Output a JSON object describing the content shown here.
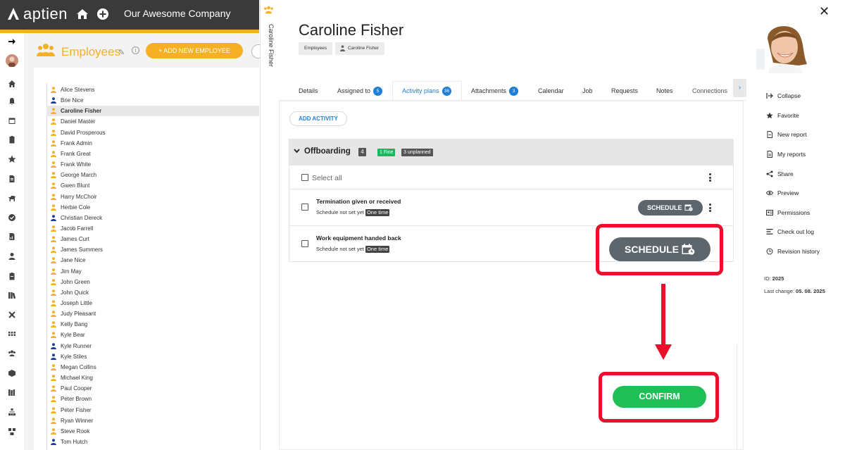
{
  "app": {
    "logo_text": "aptien",
    "company": "Our Awesome Company"
  },
  "employees_panel": {
    "title": "Employees",
    "add_button": "+ ADD NEW EMPLOYEE",
    "info_glyph": "i",
    "employees": [
      {
        "name": "Alice Stevens",
        "color": "#f5b025",
        "selected": false
      },
      {
        "name": "Brie Nice",
        "color": "#1f3f9c",
        "selected": false
      },
      {
        "name": "Caroline Fisher",
        "color": "#f5b025",
        "selected": true
      },
      {
        "name": "Daniel Master",
        "color": "#f5b025",
        "selected": false
      },
      {
        "name": "David Prosperous",
        "color": "#f5b025",
        "selected": false
      },
      {
        "name": "Frank Admin",
        "color": "#f5b025",
        "selected": false
      },
      {
        "name": "Frank Great",
        "color": "#f5b025",
        "selected": false
      },
      {
        "name": "Frank White",
        "color": "#f5b025",
        "selected": false
      },
      {
        "name": "George March",
        "color": "#f5b025",
        "selected": false
      },
      {
        "name": "Gwen Blunt",
        "color": "#f5b025",
        "selected": false
      },
      {
        "name": "Harry McChoir",
        "color": "#f5b025",
        "selected": false
      },
      {
        "name": "Herbie Cole",
        "color": "#f5b025",
        "selected": false
      },
      {
        "name": "Christian Dereck",
        "color": "#1f3f9c",
        "selected": false
      },
      {
        "name": "Jacob Farrell",
        "color": "#f5b025",
        "selected": false
      },
      {
        "name": "James Curt",
        "color": "#f5b025",
        "selected": false
      },
      {
        "name": "James Summers",
        "color": "#f5b025",
        "selected": false
      },
      {
        "name": "Jane Nice",
        "color": "#f5b025",
        "selected": false
      },
      {
        "name": "Jim May",
        "color": "#f5b025",
        "selected": false
      },
      {
        "name": "John Green",
        "color": "#f5b025",
        "selected": false
      },
      {
        "name": "John Quick",
        "color": "#f5b025",
        "selected": false
      },
      {
        "name": "Joseph Little",
        "color": "#f5b025",
        "selected": false
      },
      {
        "name": "Judy Pleasant",
        "color": "#f5b025",
        "selected": false
      },
      {
        "name": "Kelly Bang",
        "color": "#f5b025",
        "selected": false
      },
      {
        "name": "Kyle Bear",
        "color": "#f5b025",
        "selected": false
      },
      {
        "name": "Kyle Runner",
        "color": "#1f3f9c",
        "selected": false
      },
      {
        "name": "Kyle Stiles",
        "color": "#1f3f9c",
        "selected": false
      },
      {
        "name": "Megan Collins",
        "color": "#f5b025",
        "selected": false
      },
      {
        "name": "Michael King",
        "color": "#f5b025",
        "selected": false
      },
      {
        "name": "Paul Cooper",
        "color": "#f5b025",
        "selected": false
      },
      {
        "name": "Peter Brown",
        "color": "#f5b025",
        "selected": false
      },
      {
        "name": "Peter Fisher",
        "color": "#f5b025",
        "selected": false
      },
      {
        "name": "Ryan Winner",
        "color": "#f5b025",
        "selected": false
      },
      {
        "name": "Steve Rook",
        "color": "#f5b025",
        "selected": false
      },
      {
        "name": "Tom Hutch",
        "color": "#1f3f9c",
        "selected": false
      }
    ]
  },
  "rail_icons": [
    "sign-in-icon",
    "user-avatar",
    "home-icon",
    "bell-icon",
    "calendar-icon",
    "clipboard-icon",
    "star-icon",
    "document-icon",
    "dog-icon",
    "check-circle-icon",
    "reports-icon",
    "person-icon",
    "clipboard-list-icon",
    "books-icon",
    "tools-icon",
    "grid-icon",
    "team-icon",
    "cube-icon",
    "library-icon",
    "org-chart-icon",
    "hierarchy-icon"
  ],
  "vertical_tab": {
    "label": "Caroline Fisher"
  },
  "detail": {
    "name": "Caroline Fisher",
    "breadcrumb": [
      "Employees",
      "Caroline Fisher"
    ],
    "close_glyph": "✕",
    "tabs": [
      {
        "label": "Details"
      },
      {
        "label": "Assigned to",
        "badge": "5"
      },
      {
        "label": "Activity plans",
        "badge": "36",
        "active": true
      },
      {
        "label": "Attachments",
        "badge": "3"
      },
      {
        "label": "Calendar"
      },
      {
        "label": "Job"
      },
      {
        "label": "Requests"
      },
      {
        "label": "Notes"
      },
      {
        "label": "Connections"
      }
    ],
    "tab_more_glyph": "›",
    "add_activity": "ADD ACTIVITY",
    "plan": {
      "title": "Offboarding",
      "count": "4",
      "fine": "1 Fine",
      "unplanned": "3 unplanned",
      "select_all": "Select all",
      "activities": [
        {
          "title": "Termination given or received",
          "status": "Schedule not set yet",
          "frequency": "One time"
        },
        {
          "title": "Work equipment handed back",
          "status": "Schedule not set yet",
          "frequency": "One time"
        }
      ],
      "schedule_label": "SCHEDULE"
    },
    "confirm_label": "CONFIRM",
    "annotation_color": "#e8102a"
  },
  "right_menu": {
    "items": [
      {
        "label": "Collapse",
        "icon": "collapse-icon"
      },
      {
        "label": "Favorite",
        "icon": "star-icon"
      },
      {
        "label": "New report",
        "icon": "report-icon"
      },
      {
        "label": "My reports",
        "icon": "my-reports-icon"
      },
      {
        "label": "Share",
        "icon": "share-icon"
      },
      {
        "label": "Preview",
        "icon": "eye-icon"
      },
      {
        "label": "Permissions",
        "icon": "permissions-icon"
      },
      {
        "label": "Check out log",
        "icon": "log-icon"
      },
      {
        "label": "Revision history",
        "icon": "history-icon"
      }
    ],
    "id_label": "ID:",
    "id_value": "2025",
    "last_change_label": "Last change:",
    "last_change_value": "05. 08. 2025"
  },
  "colors": {
    "brand_yellow": "#f5b025",
    "accent_blue": "#1e7fd6",
    "confirm_green": "#1dbf56",
    "schedule_gray": "#5e666d",
    "fine_green": "#1db55e"
  }
}
